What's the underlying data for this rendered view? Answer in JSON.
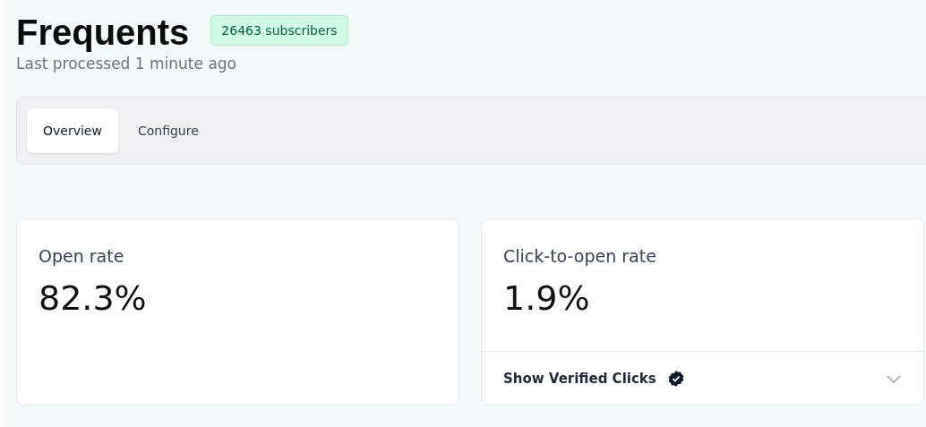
{
  "header": {
    "title": "Frequents",
    "badge": "26463 subscribers",
    "subtitle": "Last processed 1 minute ago"
  },
  "tabs": [
    {
      "label": "Overview",
      "selected": true
    },
    {
      "label": "Configure",
      "selected": false
    }
  ],
  "cards": [
    {
      "label": "Open rate",
      "value": "82.3%"
    },
    {
      "label": "Click-to-open rate",
      "value": "1.9%",
      "footer": {
        "label": "Show Verified Clicks",
        "expanded": false
      }
    }
  ]
}
